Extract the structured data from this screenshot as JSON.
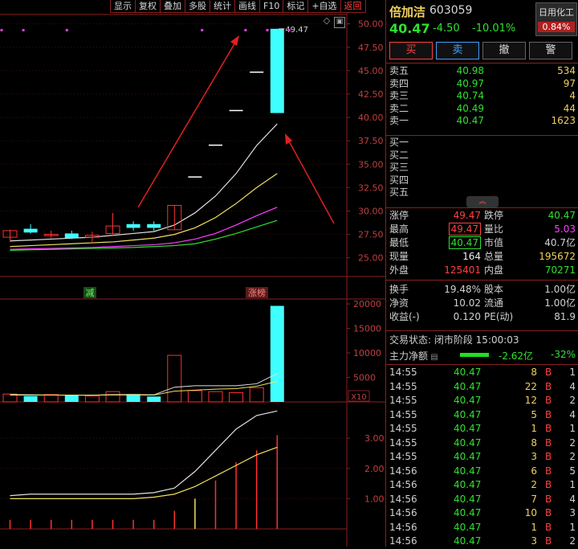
{
  "toolbar": [
    "显示",
    "复权",
    "叠加",
    "多股",
    "统计",
    "画线",
    "F10",
    "标记",
    "+自选",
    "返回"
  ],
  "chart_data": [
    {
      "type": "candlestick",
      "title": "",
      "last_high_label": "49.47",
      "ylim": [
        23,
        51
      ],
      "y_ticks": [
        "50.00",
        "47.50",
        "45.00",
        "42.50",
        "40.00",
        "37.50",
        "35.00",
        "32.50",
        "30.00",
        "27.50",
        "25.00"
      ],
      "candles": [
        {
          "o": 27.2,
          "h": 28.0,
          "l": 26.7,
          "c": 27.9,
          "color": "red"
        },
        {
          "o": 28.1,
          "h": 28.6,
          "l": 27.6,
          "c": 27.7,
          "color": "cyan"
        },
        {
          "o": 27.5,
          "h": 27.9,
          "l": 27.1,
          "c": 27.4,
          "color": "red"
        },
        {
          "o": 27.6,
          "h": 27.9,
          "l": 27.0,
          "c": 27.1,
          "color": "cyan"
        },
        {
          "o": 27.2,
          "h": 27.8,
          "l": 26.6,
          "c": 27.4,
          "color": "red"
        },
        {
          "o": 27.6,
          "h": 29.8,
          "l": 27.3,
          "c": 28.4,
          "color": "red"
        },
        {
          "o": 28.6,
          "h": 28.9,
          "l": 27.9,
          "c": 28.2,
          "color": "cyan"
        },
        {
          "o": 28.6,
          "h": 28.9,
          "l": 27.9,
          "c": 28.2,
          "color": "cyan"
        },
        {
          "o": 28.0,
          "h": 30.6,
          "l": 28.0,
          "c": 30.6,
          "color": "red"
        },
        {
          "o": 33.7,
          "h": 33.7,
          "l": 33.7,
          "c": 33.7,
          "color": "white"
        },
        {
          "o": 37.1,
          "h": 37.1,
          "l": 37.1,
          "c": 37.1,
          "color": "white"
        },
        {
          "o": 40.8,
          "h": 40.8,
          "l": 40.8,
          "c": 40.8,
          "color": "white"
        },
        {
          "o": 44.9,
          "h": 44.9,
          "l": 44.9,
          "c": 44.9,
          "color": "white"
        },
        {
          "o": 49.47,
          "h": 49.47,
          "l": 40.47,
          "c": 40.47,
          "color": "cyan"
        }
      ],
      "ma5": [
        26.8,
        26.9,
        27.0,
        27.1,
        27.2,
        27.4,
        27.6,
        27.8,
        28.5,
        29.8,
        31.6,
        34.0,
        37.0,
        39.3
      ],
      "ma10": [
        26.2,
        26.3,
        26.4,
        26.5,
        26.6,
        26.7,
        26.9,
        27.1,
        27.5,
        28.2,
        29.3,
        30.8,
        32.5,
        34.0
      ],
      "ma20": [
        25.9,
        25.95,
        26.0,
        26.05,
        26.1,
        26.2,
        26.3,
        26.4,
        26.6,
        27.0,
        27.6,
        28.5,
        29.5,
        30.4
      ],
      "ma60": [
        25.8,
        25.85,
        25.9,
        25.95,
        26.0,
        26.05,
        26.1,
        26.2,
        26.3,
        26.5,
        27.0,
        27.6,
        28.3,
        29.0
      ],
      "signals": [
        "减",
        "涨榜"
      ]
    },
    {
      "type": "bar",
      "title": "",
      "ylim": [
        0,
        21000
      ],
      "y_ticks": [
        "20000",
        "15000",
        "10000",
        "5000"
      ],
      "unit_label": "X10",
      "values": [
        1600,
        1200,
        1500,
        1400,
        1200,
        2100,
        1600,
        1100,
        9500,
        2300,
        2100,
        1900,
        2900,
        19600
      ],
      "colors": [
        "red",
        "cyan",
        "red",
        "cyan",
        "red",
        "red",
        "cyan",
        "cyan",
        "red",
        "red",
        "red",
        "red",
        "red",
        "cyan"
      ],
      "ma5": [
        1500,
        1450,
        1400,
        1380,
        1380,
        1500,
        1500,
        1450,
        3000,
        3300,
        3300,
        3300,
        3700,
        5800
      ],
      "ma10": [
        1400,
        1400,
        1400,
        1380,
        1380,
        1420,
        1420,
        1400,
        2200,
        2400,
        2600,
        2700,
        3200,
        4200
      ]
    },
    {
      "type": "bar",
      "title": "",
      "ylim": [
        0,
        4.2
      ],
      "y_ticks": [
        "3.00",
        "2.00",
        "1.00"
      ],
      "values": [
        0.3,
        0.3,
        0.3,
        0.3,
        0.3,
        0.3,
        0.3,
        0.3,
        0.6,
        1.0,
        1.6,
        2.2,
        2.6,
        3.1
      ],
      "line1": [
        1.1,
        1.15,
        1.15,
        1.15,
        1.15,
        1.15,
        1.15,
        1.2,
        1.35,
        1.9,
        2.6,
        3.3,
        3.75,
        3.9
      ],
      "line2": [
        1.0,
        1.0,
        1.0,
        1.0,
        1.0,
        1.0,
        1.0,
        1.05,
        1.15,
        1.4,
        1.75,
        2.1,
        2.45,
        2.7
      ]
    }
  ],
  "stock": {
    "name": "倍加洁",
    "code": "603059",
    "price": "40.47",
    "change": "-4.50",
    "pct": "-10.01%",
    "sector_name": "日用化工",
    "sector_pct": "0.84%"
  },
  "trade_buttons": {
    "buy": "买",
    "sell": "卖",
    "cancel": "撤",
    "alert": "警"
  },
  "asks": [
    {
      "label": "卖五",
      "price": "40.98",
      "vol": "534"
    },
    {
      "label": "卖四",
      "price": "40.97",
      "vol": "97"
    },
    {
      "label": "卖三",
      "price": "40.74",
      "vol": "4"
    },
    {
      "label": "卖二",
      "price": "40.49",
      "vol": "44"
    },
    {
      "label": "卖一",
      "price": "40.47",
      "vol": "1623"
    }
  ],
  "bids": [
    {
      "label": "买一",
      "price": "",
      "vol": ""
    },
    {
      "label": "买二",
      "price": "",
      "vol": ""
    },
    {
      "label": "买三",
      "price": "",
      "vol": ""
    },
    {
      "label": "买四",
      "price": "",
      "vol": ""
    },
    {
      "label": "买五",
      "price": "",
      "vol": ""
    }
  ],
  "stats": [
    {
      "l1": "涨停",
      "v1": "49.47",
      "c1": "#ff4040",
      "b1": "",
      "l2": "跌停",
      "v2": "40.47",
      "c2": "#30e030",
      "b2": ""
    },
    {
      "l1": "最高",
      "v1": "49.47",
      "c1": "#ff4040",
      "b1": "boxed",
      "l2": "量比",
      "v2": "5.03",
      "c2": "#ff40ff",
      "b2": ""
    },
    {
      "l1": "最低",
      "v1": "40.47",
      "c1": "#30e030",
      "b1": "boxedg",
      "l2": "市值",
      "v2": "40.7亿",
      "c2": "#d0d0d0",
      "b2": ""
    },
    {
      "l1": "现量",
      "v1": "164",
      "c1": "#f0f0f0",
      "b1": "",
      "l2": "总量",
      "v2": "195672",
      "c2": "#f0d060",
      "b2": ""
    },
    {
      "l1": "外盘",
      "v1": "125401",
      "c1": "#ff4040",
      "b1": "",
      "l2": "内盘",
      "v2": "70271",
      "c2": "#30e030",
      "b2": ""
    },
    {
      "l1": "换手",
      "v1": "19.48%",
      "c1": "#d0d0d0",
      "b1": "",
      "l2": "股本",
      "v2": "1.00亿",
      "c2": "#d0d0d0",
      "b2": ""
    },
    {
      "l1": "净资",
      "v1": "10.02",
      "c1": "#d0d0d0",
      "b1": "",
      "l2": "流通",
      "v2": "1.00亿",
      "c2": "#d0d0d0",
      "b2": ""
    },
    {
      "l1": "收益(-)",
      "v1": "0.120",
      "c1": "#d0d0d0",
      "b1": "",
      "l2": "PE(动)",
      "v2": "81.9",
      "c2": "#d0d0d0",
      "b2": ""
    }
  ],
  "state": "交易状态: 闭市阶段 15:00:03",
  "flow": {
    "label": "主力净额",
    "value": "-2.62亿",
    "pct": "-32%"
  },
  "ticks": [
    {
      "t": "14:55",
      "p": "40.47",
      "v": "8",
      "d": "B",
      "n": "1"
    },
    {
      "t": "14:55",
      "p": "40.47",
      "v": "22",
      "d": "B",
      "n": "4"
    },
    {
      "t": "14:55",
      "p": "40.47",
      "v": "12",
      "d": "B",
      "n": "2"
    },
    {
      "t": "14:55",
      "p": "40.47",
      "v": "5",
      "d": "B",
      "n": "4"
    },
    {
      "t": "14:55",
      "p": "40.47",
      "v": "1",
      "d": "B",
      "n": "1"
    },
    {
      "t": "14:55",
      "p": "40.47",
      "v": "8",
      "d": "B",
      "n": "2"
    },
    {
      "t": "14:55",
      "p": "40.47",
      "v": "3",
      "d": "B",
      "n": "2"
    },
    {
      "t": "14:56",
      "p": "40.47",
      "v": "6",
      "d": "B",
      "n": "5"
    },
    {
      "t": "14:56",
      "p": "40.47",
      "v": "2",
      "d": "B",
      "n": "1"
    },
    {
      "t": "14:56",
      "p": "40.47",
      "v": "7",
      "d": "B",
      "n": "4"
    },
    {
      "t": "14:56",
      "p": "40.47",
      "v": "10",
      "d": "B",
      "n": "3"
    },
    {
      "t": "14:56",
      "p": "40.47",
      "v": "1",
      "d": "B",
      "n": "1"
    },
    {
      "t": "14:56",
      "p": "40.47",
      "v": "3",
      "d": "B",
      "n": "2"
    }
  ]
}
